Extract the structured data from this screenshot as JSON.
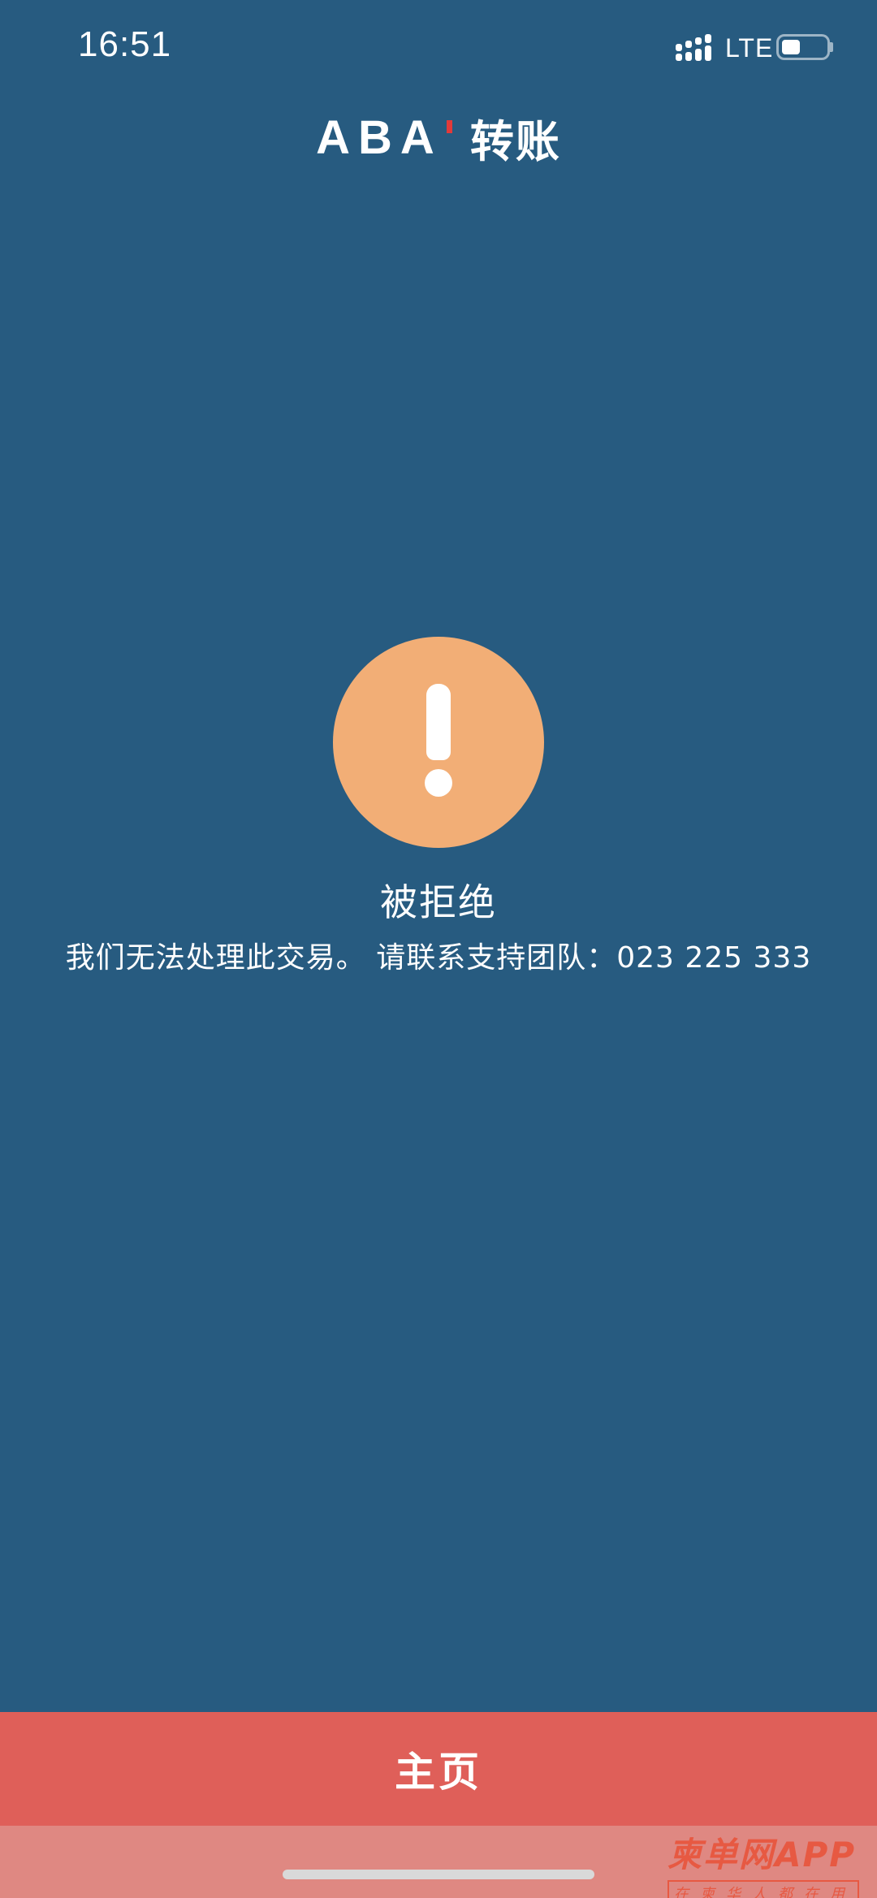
{
  "status_bar": {
    "time": "16:51",
    "network": "LTE",
    "battery_level": 0.4
  },
  "header": {
    "brand": "ABA",
    "title": "转账"
  },
  "result": {
    "icon": "warning-exclamation-icon",
    "icon_color": "#f2ae76",
    "title": "被拒绝",
    "message": "我们无法处理此交易。 请联系支持团队：023 225 333"
  },
  "footer": {
    "home_label": "主页"
  },
  "watermark": {
    "main": "柬单网APP",
    "sub": "在柬华人都在用"
  },
  "colors": {
    "background": "#275b80",
    "button": "#df5f59",
    "brand_accent": "#e23a3a"
  }
}
